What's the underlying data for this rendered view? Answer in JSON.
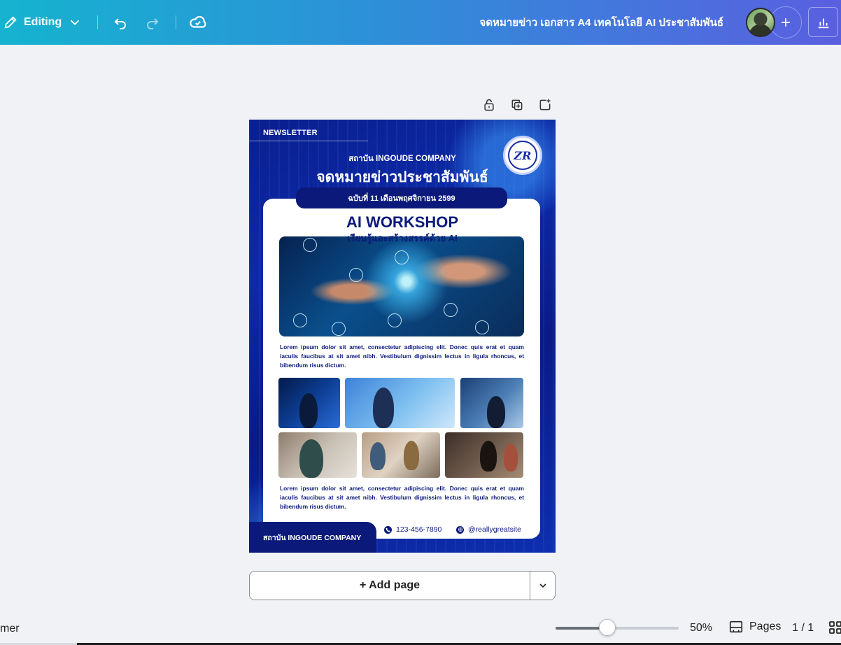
{
  "topbar": {
    "mode_label": "Editing",
    "doc_title": "จดหมายข่าว เอกสาร A4 เทคโนโลยี AI ประชาสัมพันธ์"
  },
  "design": {
    "newsletter_tag": "NEWSLETTER",
    "company_top": "สถาบัน INGOUDE COMPANY",
    "thai_title": "จดหมายข่าวประชาสัมพันธ์",
    "logo_text": "ZR",
    "issue": "ฉบับที่ 11 เดือนพฤศจิกายน 2599",
    "ai_title": "AI WORKSHOP",
    "ai_subtitle": "เรียนรู้และสร้างสรรค์ด้วย AI",
    "paragraph_1": "Lorem ipsum dolor sit amet, consectetur adipiscing elit. Donec quis erat et quam iaculis faucibus at sit amet nibh. Vestibulum dignissim lectus in ligula rhoncus, et bibendum risus dictum.",
    "paragraph_2": "Lorem ipsum dolor sit amet, consectetur adipiscing elit. Donec quis erat et quam iaculis faucibus at sit amet nibh. Vestibulum dignissim lectus in ligula rhoncus, et bibendum risus dictum.",
    "footer_company": "สถาบัน INGOUDE COMPANY",
    "phone": "123-456-7890",
    "website": "@reallygreatsite"
  },
  "canvas": {
    "add_page_label": "+ Add page"
  },
  "bottombar": {
    "notes_label": "mer",
    "zoom_label": "50%",
    "zoom_fraction": 0.42,
    "pages_label": "Pages",
    "page_count": "1 / 1"
  },
  "colors": {
    "brand_gradient_start": "#15b3cf",
    "brand_gradient_end": "#5a5fe0",
    "newsletter_navy": "#0b1a7a"
  }
}
